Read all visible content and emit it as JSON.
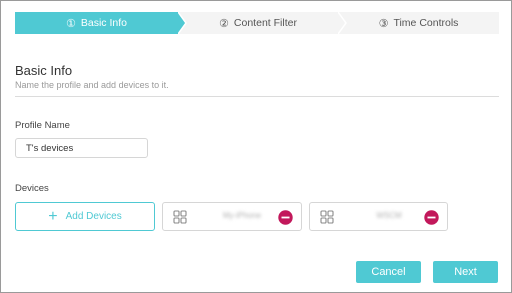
{
  "stepper": {
    "steps": [
      {
        "number": "①",
        "label": "Basic Info",
        "active": true
      },
      {
        "number": "②",
        "label": "Content Filter",
        "active": false
      },
      {
        "number": "③",
        "label": "Time Controls",
        "active": false
      }
    ]
  },
  "section": {
    "title": "Basic Info",
    "subtitle": "Name the profile and add devices to it."
  },
  "profile": {
    "label": "Profile Name",
    "value": "T's devices"
  },
  "devices": {
    "label": "Devices",
    "add_label": "Add Devices",
    "items": [
      {
        "name": "My-iPhone",
        "icon": "grid-icon"
      },
      {
        "name": "WSCM",
        "icon": "grid-icon"
      }
    ]
  },
  "footer": {
    "cancel_label": "Cancel",
    "next_label": "Next"
  },
  "colors": {
    "accent": "#4fc9d3",
    "remove": "#c2185b"
  }
}
